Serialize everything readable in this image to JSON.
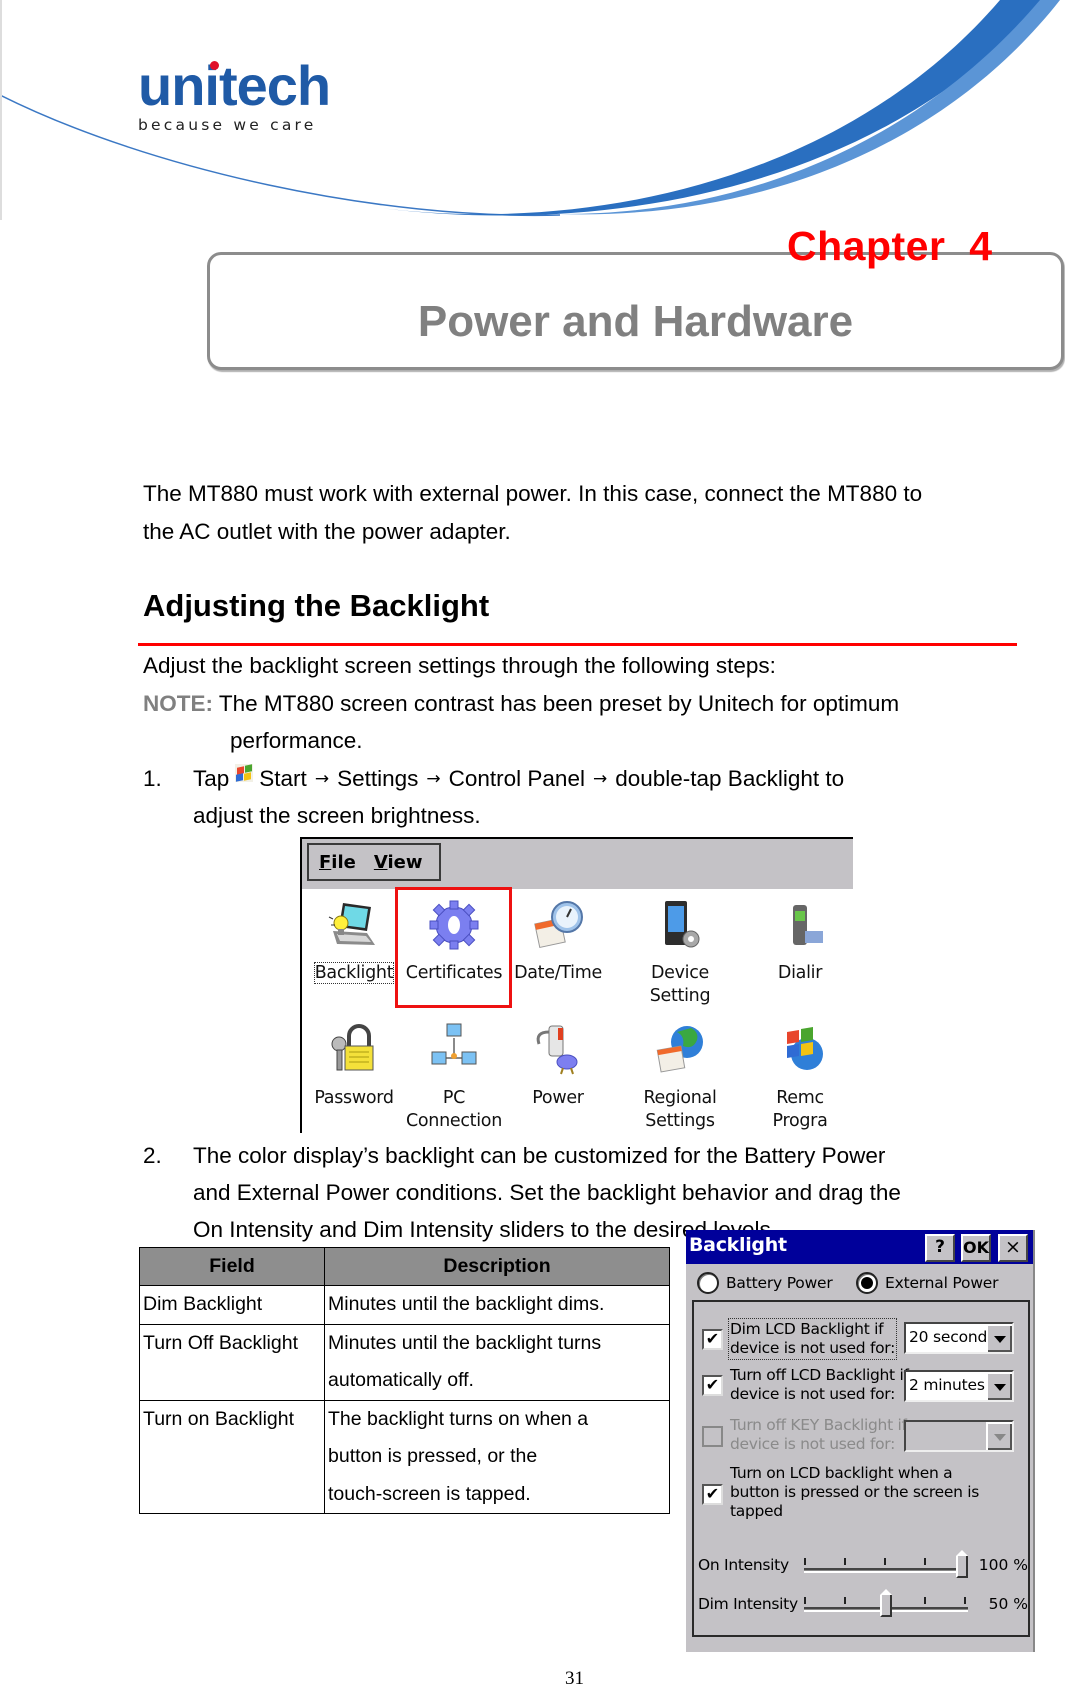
{
  "brand": {
    "name": "unitech",
    "tagline": "because we care",
    "logo_color": "#1f5aa6",
    "dot_color": "#e0102a",
    "swoosh_color": "#2a6fc0"
  },
  "chapter": {
    "label": "Chapter  4",
    "title": "Power and Hardware",
    "label_color": "#ff0000",
    "title_color": "#808080"
  },
  "intro": {
    "line1": "The MT880 must work with external power. In this case, connect the MT880 to",
    "line2": "the AC outlet with the power adapter."
  },
  "section": {
    "heading": "Adjusting the Backlight",
    "rule_color": "#ff0000",
    "lead": "Adjust the backlight screen settings through the following steps:",
    "note_label": "NOTE:",
    "note_text": " The MT880 screen contrast has been preset by Unitech for optimum",
    "note_cont": "performance."
  },
  "step1": {
    "number": "1.",
    "tap": "Tap",
    "start_icon": "windows-start-icon",
    "path": [
      "Start",
      "Settings",
      "Control Panel",
      "double-tap Backlight to"
    ],
    "arrow": "→",
    "line2": "adjust the screen brightness."
  },
  "control_panel": {
    "menu": [
      {
        "label": "File",
        "accel": "F",
        "rest": "ile"
      },
      {
        "label": "View",
        "accel": "V",
        "rest": "iew"
      }
    ],
    "items": [
      {
        "label": "Backlight",
        "icon": "backlight-laptop-icon",
        "focused": true
      },
      {
        "label": "Certificates",
        "icon": "certificates-gear-icon",
        "highlighted": true
      },
      {
        "label": "Date/Time",
        "icon": "date-time-clock-icon"
      },
      {
        "label": "Device\nSetting",
        "line1": "Device",
        "line2": "Setting",
        "icon": "device-setting-icon"
      },
      {
        "label": "Dialir",
        "icon": "dialing-phone-icon"
      },
      {
        "label": "Password",
        "icon": "password-lock-icon"
      },
      {
        "label": "PC Connection",
        "line1": "PC",
        "line2": "Connection",
        "icon": "pc-connection-icon"
      },
      {
        "label": "Power",
        "icon": "power-battery-icon"
      },
      {
        "label": "Regional Settings",
        "line1": "Regional",
        "line2": "Settings",
        "icon": "regional-globe-icon"
      },
      {
        "label": "Remo Progra",
        "line1": "Remc",
        "line2": "Progra",
        "icon": "remove-programs-icon"
      }
    ]
  },
  "step2": {
    "number": "2.",
    "line1": "The color display’s backlight can be customized for the Battery Power",
    "line2": "and External Power conditions. Set the backlight behavior and drag the",
    "line3": "On Intensity and Dim Intensity sliders to the desired levels."
  },
  "field_table": {
    "headers": [
      "Field",
      "Description"
    ],
    "header_bg": "#8e8e8e",
    "rows": [
      {
        "field": "Dim Backlight",
        "description": [
          "Minutes until the backlight dims."
        ]
      },
      {
        "field": "Turn Off Backlight",
        "description": [
          "Minutes until the backlight turns",
          "automatically off."
        ]
      },
      {
        "field": "Turn on Backlight",
        "description": [
          "The backlight turns on when a",
          "button is pressed, or the",
          "touch-screen is tapped."
        ]
      }
    ]
  },
  "dialog": {
    "title": "Backlight",
    "title_bg": "#00009a",
    "buttons": {
      "help": "?",
      "ok": "OK",
      "close": "×"
    },
    "power_source": {
      "options": [
        "Battery Power",
        "External Power"
      ],
      "selected": "External Power"
    },
    "options": [
      {
        "line1": "Dim LCD Backlight if",
        "line2": "device is not used for:",
        "checked": true,
        "enabled": true,
        "value": "20 second"
      },
      {
        "line1": "Turn off LCD Backlight if",
        "line2": "device is not used for:",
        "checked": true,
        "enabled": true,
        "value": "2 minutes"
      },
      {
        "line1": "Turn off KEY Backlight if",
        "line2": "device is not used for:",
        "checked": false,
        "enabled": false,
        "value": ""
      },
      {
        "line1": "Turn on LCD backlight when a",
        "line2": "button is pressed or the screen is",
        "line3": "tapped",
        "checked": true,
        "enabled": true
      }
    ],
    "sliders": [
      {
        "label": "On Intensity",
        "value_text": "100 %",
        "value_percent": 100
      },
      {
        "label": "Dim Intensity",
        "value_text": "50 %",
        "value_percent": 50
      }
    ],
    "check_mark": "✔"
  },
  "page_number": "31"
}
